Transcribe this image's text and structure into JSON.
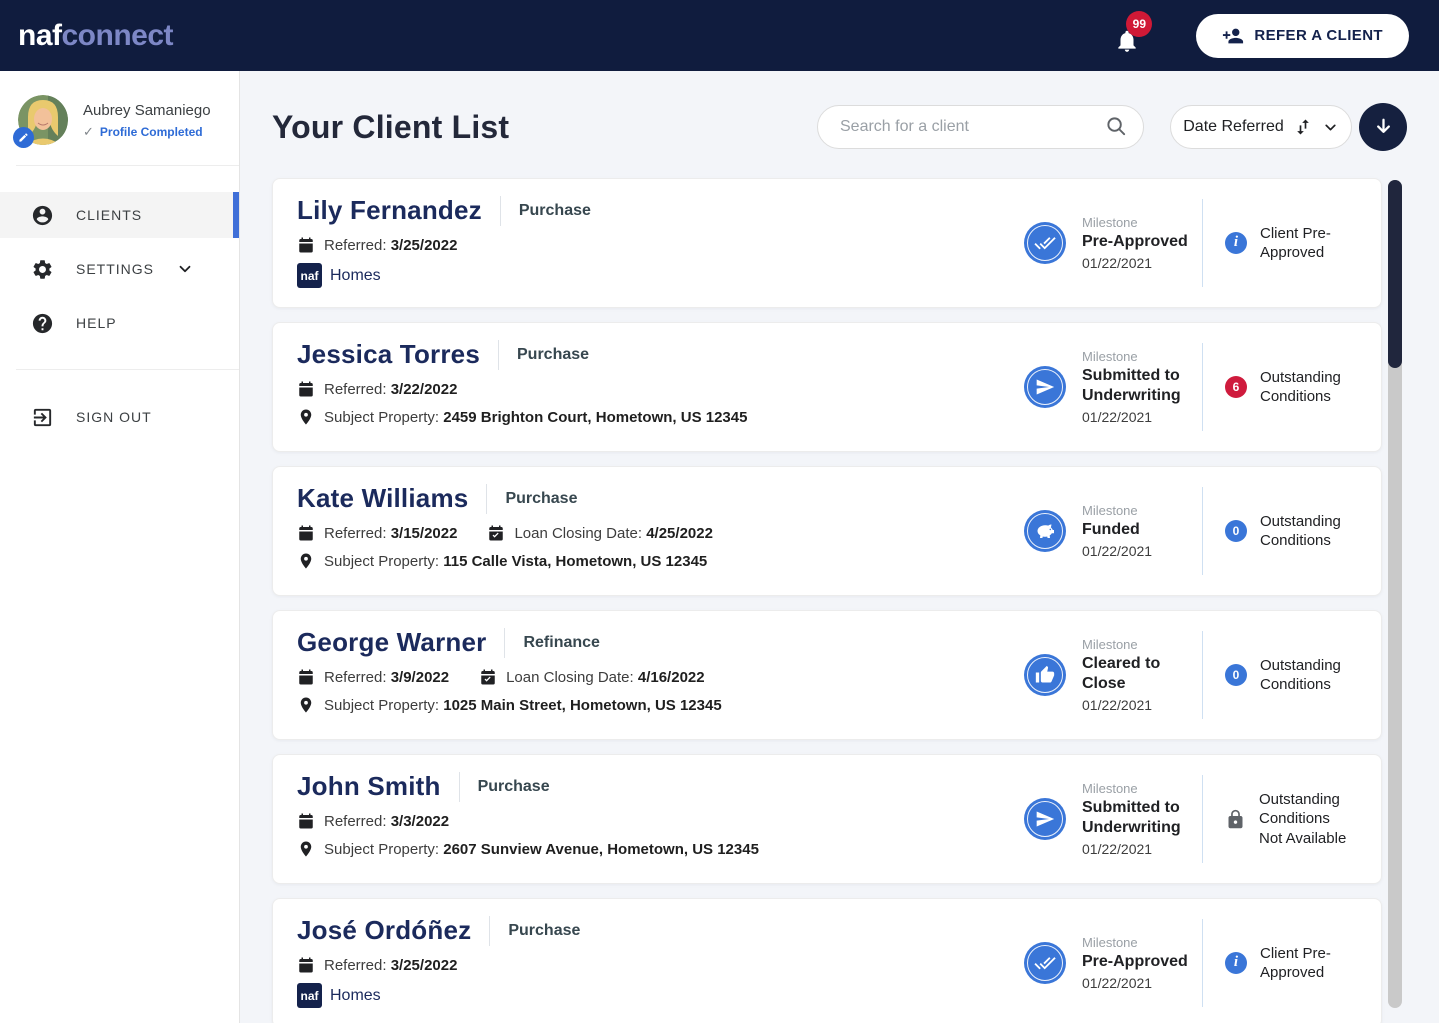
{
  "topbar": {
    "logo_naf": "naf",
    "logo_connect": "connect",
    "notifications_count": "99",
    "refer_button_label": "REFER A CLIENT"
  },
  "sidebar": {
    "user_name": "Aubrey Samaniego",
    "user_status": "Profile Completed",
    "status_check": "✓",
    "nav": {
      "clients": "CLIENTS",
      "settings": "SETTINGS",
      "help": "HELP",
      "sign_out": "SIGN OUT"
    }
  },
  "main": {
    "title": "Your Client List",
    "search_placeholder": "Search for a client",
    "sort_label": "Date Referred"
  },
  "labels": {
    "referred": "Referred:",
    "closing": "Loan Closing Date:",
    "property": "Subject Property:",
    "milestone": "Milestone",
    "naf_chip": "naf",
    "homes": "Homes"
  },
  "colors": {
    "navy": "#101c3e",
    "accent_blue": "#3a76d8",
    "alert_red": "#d01936",
    "name_navy": "#1b2a5c"
  },
  "clients": [
    {
      "name": "Lily Fernandez",
      "loan_type": "Purchase",
      "referred": "3/25/2022",
      "homes": true,
      "milestone": {
        "name": "Pre-Approved",
        "date": "01/22/2021",
        "icon": "done-all"
      },
      "status": {
        "kind": "info",
        "text": "Client Pre-Approved"
      }
    },
    {
      "name": "Jessica Torres",
      "loan_type": "Purchase",
      "referred": "3/22/2022",
      "property": "2459 Brighton Court, Hometown, US 12345",
      "milestone": {
        "name": "Submitted to Underwriting",
        "date": "01/22/2021",
        "icon": "send"
      },
      "status": {
        "kind": "count",
        "count": "6",
        "color": "red",
        "text": "Outstanding Conditions"
      }
    },
    {
      "name": "Kate Williams",
      "loan_type": "Purchase",
      "referred": "3/15/2022",
      "closing": "4/25/2022",
      "property": "115 Calle Vista, Hometown, US 12345",
      "milestone": {
        "name": "Funded",
        "date": "01/22/2021",
        "icon": "piggy"
      },
      "status": {
        "kind": "count",
        "count": "0",
        "color": "blue",
        "text": "Outstanding Conditions"
      }
    },
    {
      "name": "George Warner",
      "loan_type": "Refinance",
      "referred": "3/9/2022",
      "closing": "4/16/2022",
      "property": "1025 Main Street, Hometown, US 12345",
      "milestone": {
        "name": "Cleared to Close",
        "date": "01/22/2021",
        "icon": "thumb-up"
      },
      "status": {
        "kind": "count",
        "count": "0",
        "color": "blue",
        "text": "Outstanding Conditions"
      }
    },
    {
      "name": "John Smith",
      "loan_type": "Purchase",
      "referred": "3/3/2022",
      "property": "2607 Sunview Avenue, Hometown, US 12345",
      "milestone": {
        "name": "Submitted to Underwriting",
        "date": "01/22/2021",
        "icon": "send"
      },
      "status": {
        "kind": "lock",
        "text": "Outstanding Conditions Not Available"
      }
    },
    {
      "name": "José Ordóñez",
      "loan_type": "Purchase",
      "referred": "3/25/2022",
      "homes": true,
      "milestone": {
        "name": "Pre-Approved",
        "date": "01/22/2021",
        "icon": "done-all"
      },
      "status": {
        "kind": "info",
        "text": "Client Pre-Approved"
      }
    }
  ]
}
